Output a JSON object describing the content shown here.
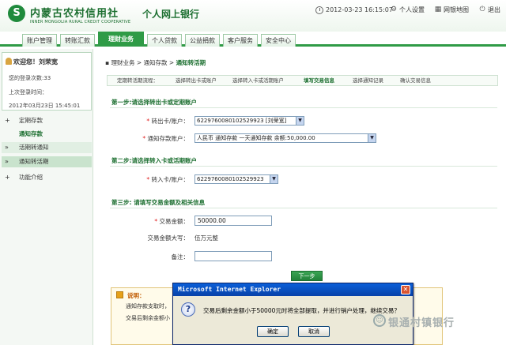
{
  "header": {
    "logo_mark": "S",
    "logo_cn": "内蒙古农村信用社",
    "logo_en": "INNER MONGOLIA RURAL CREDIT COOPERATIVE",
    "title": "个人网上银行",
    "datetime": "2012-03-23 16:15:07",
    "links": [
      "个人设置",
      "网银地图",
      "退出"
    ]
  },
  "nav": {
    "tabs": [
      "账户管理",
      "转账汇款",
      "理财业务",
      "个人贷款",
      "公益捐款",
      "客户服务",
      "安全中心"
    ],
    "active": "理财业务"
  },
  "sidebar": {
    "welcome": "欢迎您！刘荣宽",
    "login_count": "您的登录次数:33",
    "last_login_label": "上次登录时间：",
    "last_login_time": "2012年03月23日 15:45:01",
    "menu": [
      {
        "mark": "+",
        "label": "定期存款"
      },
      {
        "mark": "",
        "label": "通知存款"
      },
      {
        "mark": "»",
        "label": "活期转通知"
      },
      {
        "mark": "»",
        "label": "通知转活期"
      },
      {
        "mark": "+",
        "label": "功能介绍"
      }
    ]
  },
  "main": {
    "breadcrumb": {
      "part1": "理财业务",
      "sep": " > ",
      "part2": "通知存款",
      "part3": "通知转活期"
    },
    "steps": [
      "定期转活期流程：",
      "选择转出卡或账户",
      "选择转入卡或活期账户",
      "填写交易信息",
      "选择通知记录",
      "确认交易信息"
    ],
    "step1": {
      "title": "第一步:请选择转出卡或定期账户",
      "field1_label": "转出卡/账户：",
      "field1_value": "6229760080102529923 [刘荣宽]",
      "field2_label": "通知存款账户：",
      "field2_value": "人民币 通知存款 一天通知存款 余额:50,000.00"
    },
    "step2": {
      "title": "第二步:请选择转入卡或活期账户",
      "field_label": "转入卡/账户：",
      "field_value": "6229760080102529923"
    },
    "step3": {
      "title": "第三步: 请填写交易金额及相关信息",
      "amount_label": "交易金额：",
      "amount_value": "50000.00",
      "upper_label": "交易金额大写：",
      "upper_value": "伍万元整",
      "note_label": "备注："
    },
    "next_button": "下一步",
    "notice": {
      "title": "说明：",
      "line1": "通知存款支取时，",
      "line2": "交易后剩余金额小"
    }
  },
  "dialog": {
    "title": "Microsoft Internet Explorer",
    "close": "✕",
    "icon": "?",
    "message": "交易后剩余金额小于50000元时将全部提取，并进行销户处理，继续交易？",
    "ok": "确定",
    "cancel": "取消"
  },
  "watermark": "银通村镇银行"
}
